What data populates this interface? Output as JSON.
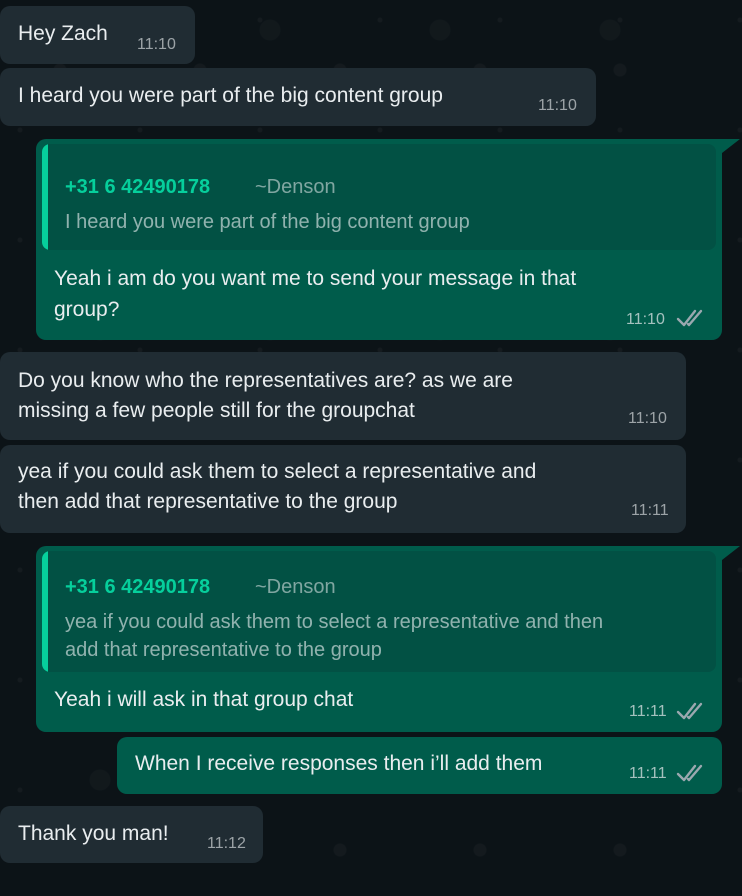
{
  "messages": [
    {
      "id": "m1",
      "direction": "incoming",
      "text": "Hey Zach",
      "time": "11:10"
    },
    {
      "id": "m2",
      "direction": "incoming",
      "text": "I heard you were part of the big content group",
      "time": "11:10"
    },
    {
      "id": "m3",
      "direction": "outgoing",
      "quote": {
        "phone": "+31 6 42490178",
        "name": "~Denson",
        "text": "I heard you were part of the big content group"
      },
      "lines": [
        "Yeah i am do you want me to send your message in that",
        "group?"
      ],
      "time": "11:10",
      "status": "read-double-check-icon"
    },
    {
      "id": "m4",
      "direction": "incoming",
      "lines": [
        "Do you know who the representatives are? as we are",
        "missing a few people still for the groupchat"
      ],
      "time": "11:10"
    },
    {
      "id": "m5",
      "direction": "incoming",
      "lines": [
        "yea if you could ask them to select a representative and",
        "then add that representative to the group"
      ],
      "time": "11:11"
    },
    {
      "id": "m6",
      "direction": "outgoing",
      "quote": {
        "phone": "+31 6 42490178",
        "name": "~Denson",
        "lines": [
          "yea if you could ask them to select a representative and then",
          "add that representative to the group"
        ]
      },
      "text": "Yeah i will ask in that group chat",
      "time": "11:11",
      "status": "read-double-check-icon"
    },
    {
      "id": "m7",
      "direction": "outgoing",
      "text": "When I receive responses then i’ll add them",
      "time": "11:11",
      "status": "read-double-check-icon"
    },
    {
      "id": "m8",
      "direction": "incoming",
      "text": "Thank you man!",
      "time": "11:12"
    }
  ],
  "colors": {
    "background": "#0c1317",
    "incoming_bubble": "#202c33",
    "outgoing_bubble": "#005c4b",
    "quote_background": "#025144",
    "quote_accent": "#06cf9c"
  }
}
